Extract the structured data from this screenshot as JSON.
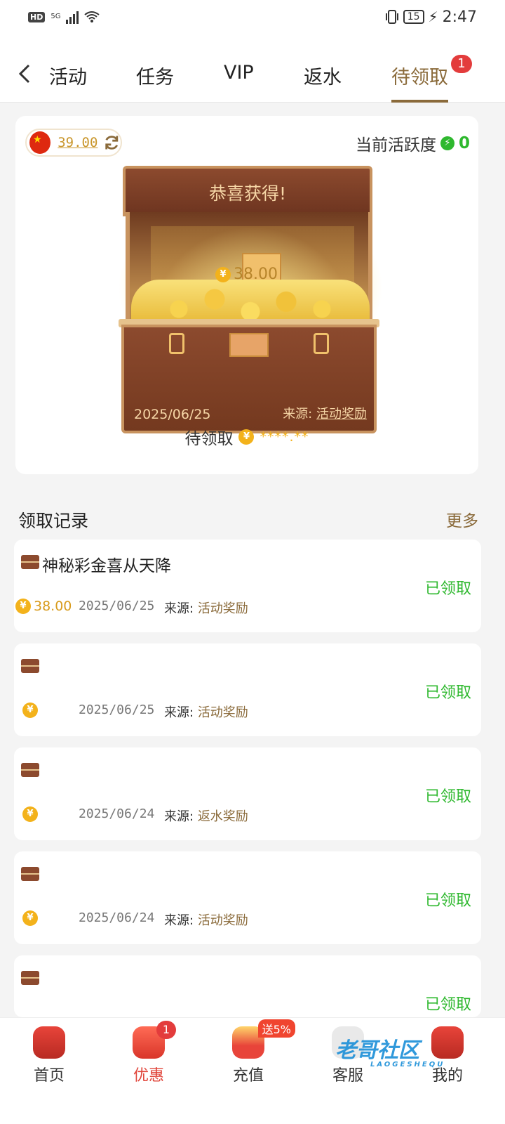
{
  "status_bar": {
    "hd": "HD",
    "net": "5G",
    "battery": "15",
    "time": "2:47"
  },
  "header": {
    "tabs": [
      {
        "label": "活动"
      },
      {
        "label": "任务"
      },
      {
        "label": "VIP"
      },
      {
        "label": "返水"
      },
      {
        "label": "待领取",
        "badge": "1",
        "active": true
      }
    ]
  },
  "wallet": {
    "balance": "39.00",
    "activity_label": "当前活跃度",
    "activity_value": "0"
  },
  "chest": {
    "title": "恭喜获得!",
    "amount": "38.00",
    "date": "2025/06/25",
    "source_label": "来源:",
    "source_value": "活动奖励",
    "pending_label": "待领取",
    "masked_amount": "****.**"
  },
  "records": {
    "title": "领取记录",
    "more": "更多",
    "currency_symbol": "¥",
    "items": [
      {
        "title": "神秘彩金喜从天降",
        "status": "已领取",
        "amount": "38.00",
        "date": "2025/06/25",
        "source_label": "来源:",
        "source": "活动奖励"
      },
      {
        "title": "",
        "status": "已领取",
        "amount": "",
        "date": "2025/06/25",
        "source_label": "来源:",
        "source": "活动奖励"
      },
      {
        "title": "",
        "status": "已领取",
        "amount": "",
        "date": "2025/06/24",
        "source_label": "来源:",
        "source": "返水奖励"
      },
      {
        "title": "",
        "status": "已领取",
        "amount": "",
        "date": "2025/06/24",
        "source_label": "来源:",
        "source": "活动奖励"
      },
      {
        "title": "",
        "status": "已领取",
        "amount": "",
        "date": "",
        "source_label": "",
        "source": ""
      }
    ]
  },
  "bottom_nav": {
    "items": [
      {
        "label": "首页",
        "icon": "home-icon"
      },
      {
        "label": "优惠",
        "icon": "promo-bag-icon",
        "badge": "1"
      },
      {
        "label": "充值",
        "icon": "deposit-icon",
        "promo": "送5%"
      },
      {
        "label": "客服",
        "icon": "support-icon"
      },
      {
        "label": "我的",
        "icon": "profile-icon"
      }
    ]
  },
  "watermark": {
    "text": "老哥社区",
    "sub": "LAOGESHEQU"
  },
  "colors": {
    "accent": "#8a6a3a",
    "success": "#2eb82e",
    "badge": "#e33c3c",
    "coin": "#f3b21b"
  }
}
